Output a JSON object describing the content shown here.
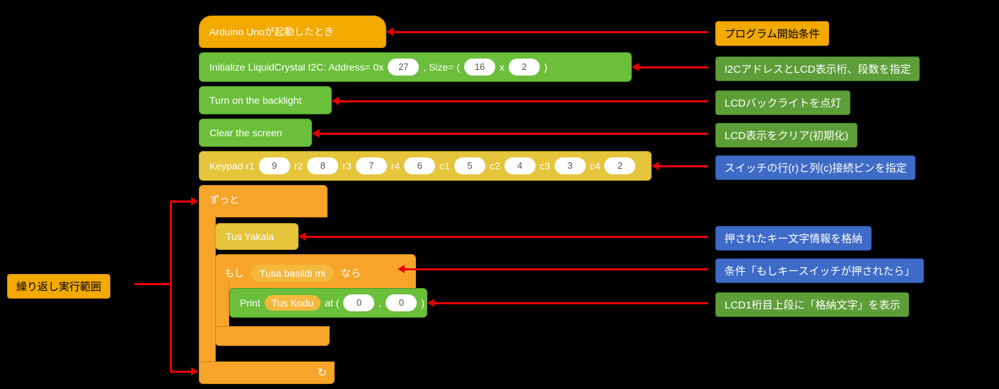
{
  "blocks": {
    "hat_label": "Arduino Unoが起動したとき",
    "init_lcd_prefix": "Initialize LiquidCrystal I2C: Address= 0x",
    "init_lcd_addr": "27",
    "init_lcd_mid": ", Size= (",
    "init_lcd_cols": "16",
    "init_lcd_x": "x",
    "init_lcd_rows": "2",
    "init_lcd_suffix": ")",
    "backlight": "Turn on the backlight",
    "clear": "Clear the screen",
    "keypad_prefix": "Keypad r1",
    "keypad_r1": "9",
    "keypad_r2_lbl": "r2",
    "keypad_r2": "8",
    "keypad_r3_lbl": "r3",
    "keypad_r3": "7",
    "keypad_r4_lbl": "r4",
    "keypad_r4": "6",
    "keypad_c1_lbl": "c1",
    "keypad_c1": "5",
    "keypad_c2_lbl": "c2",
    "keypad_c2": "4",
    "keypad_c3_lbl": "c3",
    "keypad_c3": "3",
    "keypad_c4_lbl": "c4",
    "keypad_c4": "2",
    "forever": "ずっと",
    "tus_yakala": "Tus Yakala",
    "if_left": "もし",
    "if_cond": "Tusa basildi mi",
    "if_right": "なら",
    "print_prefix": "Print",
    "print_var": "Tus Kodu",
    "print_mid": "at (",
    "print_x": "0",
    "print_comma": ",",
    "print_y": "0",
    "print_suffix": ")"
  },
  "comments": {
    "repeat_range": "繰り返し実行範囲",
    "start_cond": "プログラム開始条件",
    "i2c_lcd": "I2CアドレスとLCD表示桁、段数を指定",
    "backlight_on": "LCDバックライトを点灯",
    "clear_init": "LCD表示をクリア(初期化)",
    "keypad_pins": "スイッチの行(r)と列(c)接続ピンを指定",
    "key_store": "押されたキー文字情報を格納",
    "if_note": "条件「もしキースイッチが押されたら」",
    "print_note": "LCD1桁目上段に「格納文字」を表示"
  },
  "icons": {
    "loop_arrow": "↻"
  }
}
